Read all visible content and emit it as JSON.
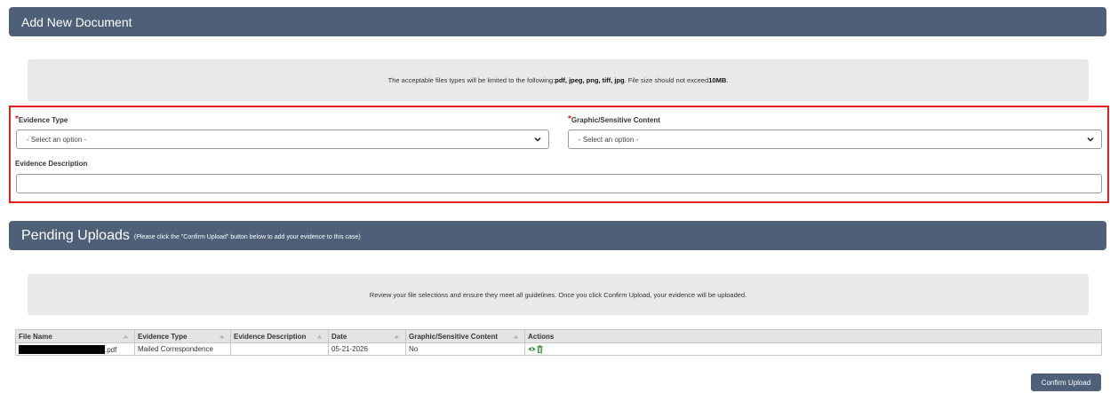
{
  "add_document": {
    "title": "Add New Document",
    "notice": {
      "prefix": "The acceptable files types will be limited to the following: ",
      "types": "pdf, jpeg, png, tiff, jpg",
      "middle": ". File size should not exceed ",
      "size": "10MB",
      "suffix": "."
    },
    "required_marker": "*",
    "evidence_type": {
      "label": "Evidence Type",
      "value": "- Select an option -"
    },
    "graphic_content": {
      "label": "Graphic/Sensitive Content",
      "value": "- Select an option -"
    },
    "evidence_description": {
      "label": "Evidence Description",
      "value": ""
    }
  },
  "pending": {
    "title": "Pending Uploads",
    "subtitle": "(Please click the \"Confirm Upload\" button below to add your evidence to this case)",
    "notice": "Review your file selections and ensure they meet all guidelines. Once you click Confirm Upload, your evidence will be uploaded.",
    "columns": [
      "File Name",
      "Evidence Type",
      "Evidence Description",
      "Date",
      "Graphic/Sensitive Content",
      "Actions"
    ],
    "rows": [
      {
        "file_ext": ".pdf",
        "evidence_type": "Mailed Correspondence",
        "description": "",
        "date": "05-21-2026",
        "graphic": "No",
        "actions": [
          "eye-icon",
          "trash-icon"
        ]
      }
    ],
    "confirm_label": "Confirm Upload"
  },
  "colors": {
    "header_bg": "#4d6077",
    "notice_bg": "#e9e9ea",
    "required": "#e02020",
    "highlight_border": "#e02020",
    "action_icon": "#2e8b2e"
  }
}
